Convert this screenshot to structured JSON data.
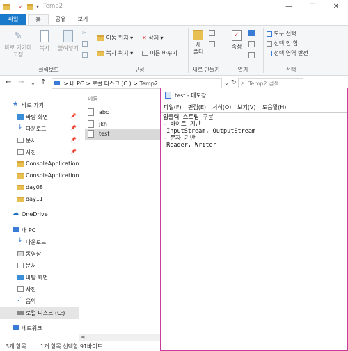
{
  "window": {
    "title": "Temp2"
  },
  "window_controls": {
    "minimize": "—",
    "maximize": "☐",
    "close": "✕"
  },
  "ribbon_tabs": [
    "파일",
    "홈",
    "공유",
    "보기"
  ],
  "ribbon": {
    "clipboard": {
      "pin": "바로 가기에\n고정",
      "copy": "복사",
      "paste": "붙여넣기",
      "group": "클립보드"
    },
    "organize": {
      "move_to": "이동 위치",
      "copy_to": "복사 위치",
      "delete": "삭제",
      "rename": "이름 바꾸기",
      "group": "구성"
    },
    "new": {
      "new_folder": "새\n폴더",
      "group": "새로 만들기"
    },
    "open": {
      "properties": "속성",
      "group": "열기"
    },
    "select": {
      "select_all": "모두 선택",
      "select_none": "선택 안 함",
      "invert": "선택 영역 반전",
      "group": "선택"
    }
  },
  "address": {
    "crumbs": "> 내 PC  >  로컬 디스크 (C:)  >  Temp2",
    "search_placeholder": "Temp2 검색"
  },
  "nav": {
    "quick_access": "바로 가기",
    "items": [
      {
        "label": "바탕 화면",
        "pinned": true
      },
      {
        "label": "다운로드",
        "pinned": true
      },
      {
        "label": "문서",
        "pinned": true
      },
      {
        "label": "사진",
        "pinned": true
      },
      {
        "label": "ConsoleApplication",
        "pinned": false
      },
      {
        "label": "ConsoleApplication",
        "pinned": false
      },
      {
        "label": "day08",
        "pinned": false
      },
      {
        "label": "day11",
        "pinned": false
      }
    ],
    "onedrive": "OneDrive",
    "this_pc": "내 PC",
    "pc_items": [
      "다운로드",
      "동영상",
      "문서",
      "바탕 화면",
      "사진",
      "음악",
      "로컬 디스크 (C:)"
    ],
    "network": "네트워크"
  },
  "file_list": {
    "header": "이름",
    "files": [
      "abc",
      "jkh",
      "test"
    ],
    "selected": "test"
  },
  "status": {
    "count": "3개 항목",
    "selection": "1개 항목 선택함 91바이트"
  },
  "notepad": {
    "title": "test - 메모장",
    "menu": [
      "파일(F)",
      "편집(E)",
      "서식(O)",
      "보기(V)",
      "도움말(H)"
    ],
    "content": "입출력 스트림 구분\n- 바이트 기반\n InputStream, OutputStream\n- 문자 기반\n Reader, Writer"
  }
}
